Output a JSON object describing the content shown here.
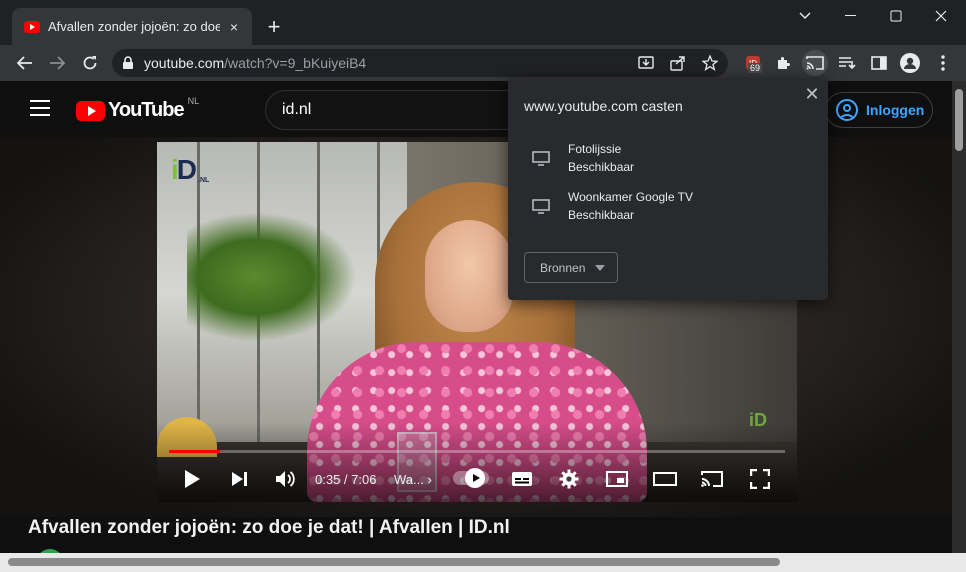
{
  "tab": {
    "title": "Afvallen zonder jojoën: zo doe je dat! | Afvallen | ID.nl",
    "close_icon": "×"
  },
  "window": {
    "new_tab_icon": "+"
  },
  "omnibox": {
    "host": "youtube.com",
    "path": "/watch?v=9_bKuiyeiB4"
  },
  "extensions": {
    "badge_count": "69"
  },
  "youtube": {
    "logo_text": "YouTube",
    "country": "NL",
    "search_value": "id.nl",
    "login_label": "Inloggen",
    "video_brand": {
      "i": "i",
      "d": "D",
      "nl": ".NL"
    },
    "watermark": "iD",
    "time": "0:35 / 7:06",
    "chapter": "Wa...",
    "chapter_chevron": "›",
    "progress_fraction": 0.082,
    "video_title": "Afvallen zonder jojoën: zo doe je dat! | Afvallen | ID.nl"
  },
  "cast_popup": {
    "title": "www.youtube.com casten",
    "close_icon": "✕",
    "sinks": [
      {
        "name": "Fotolijssie",
        "status": "Beschikbaar"
      },
      {
        "name": "Woonkamer Google TV",
        "status": "Beschikbaar"
      }
    ],
    "sources_label": "Bronnen"
  },
  "colors": {
    "brand_red": "#ff0000",
    "link_blue": "#3ea6ff",
    "popup_bg": "#292a2d"
  }
}
